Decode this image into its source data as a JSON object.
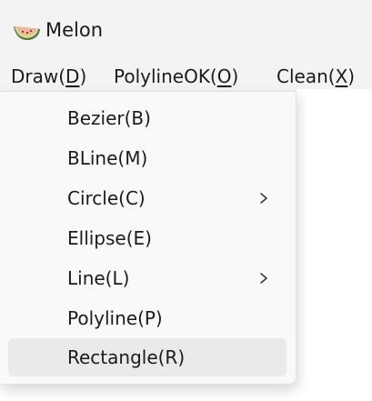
{
  "window": {
    "title": "Melon",
    "icon": "melon-slice-icon"
  },
  "menubar": {
    "items": [
      {
        "label": "Draw(",
        "mnemonic": "D",
        "suffix": ")"
      },
      {
        "label": "PolylineOK(",
        "mnemonic": "O",
        "suffix": ")"
      },
      {
        "label": "Clean(",
        "mnemonic": "X",
        "suffix": ")"
      }
    ]
  },
  "draw_menu": {
    "items": [
      {
        "label": "Bezier(B)",
        "submenu": false
      },
      {
        "label": "BLine(M)",
        "submenu": false
      },
      {
        "label": "Circle(C)",
        "submenu": true,
        "submenu_icon": "chevron-right-icon"
      },
      {
        "label": "Ellipse(E)",
        "submenu": false
      },
      {
        "label": "Line(L)",
        "submenu": true,
        "submenu_icon": "chevron-right-icon"
      },
      {
        "label": "Polyline(P)",
        "submenu": false
      },
      {
        "label": "Rectangle(R)",
        "submenu": false,
        "highlighted": true
      }
    ]
  },
  "colors": {
    "chrome_background": "#f3f3f3",
    "menu_background": "#f9f9f9",
    "highlight": "#eaeaea",
    "client_background": "#ffffff"
  }
}
